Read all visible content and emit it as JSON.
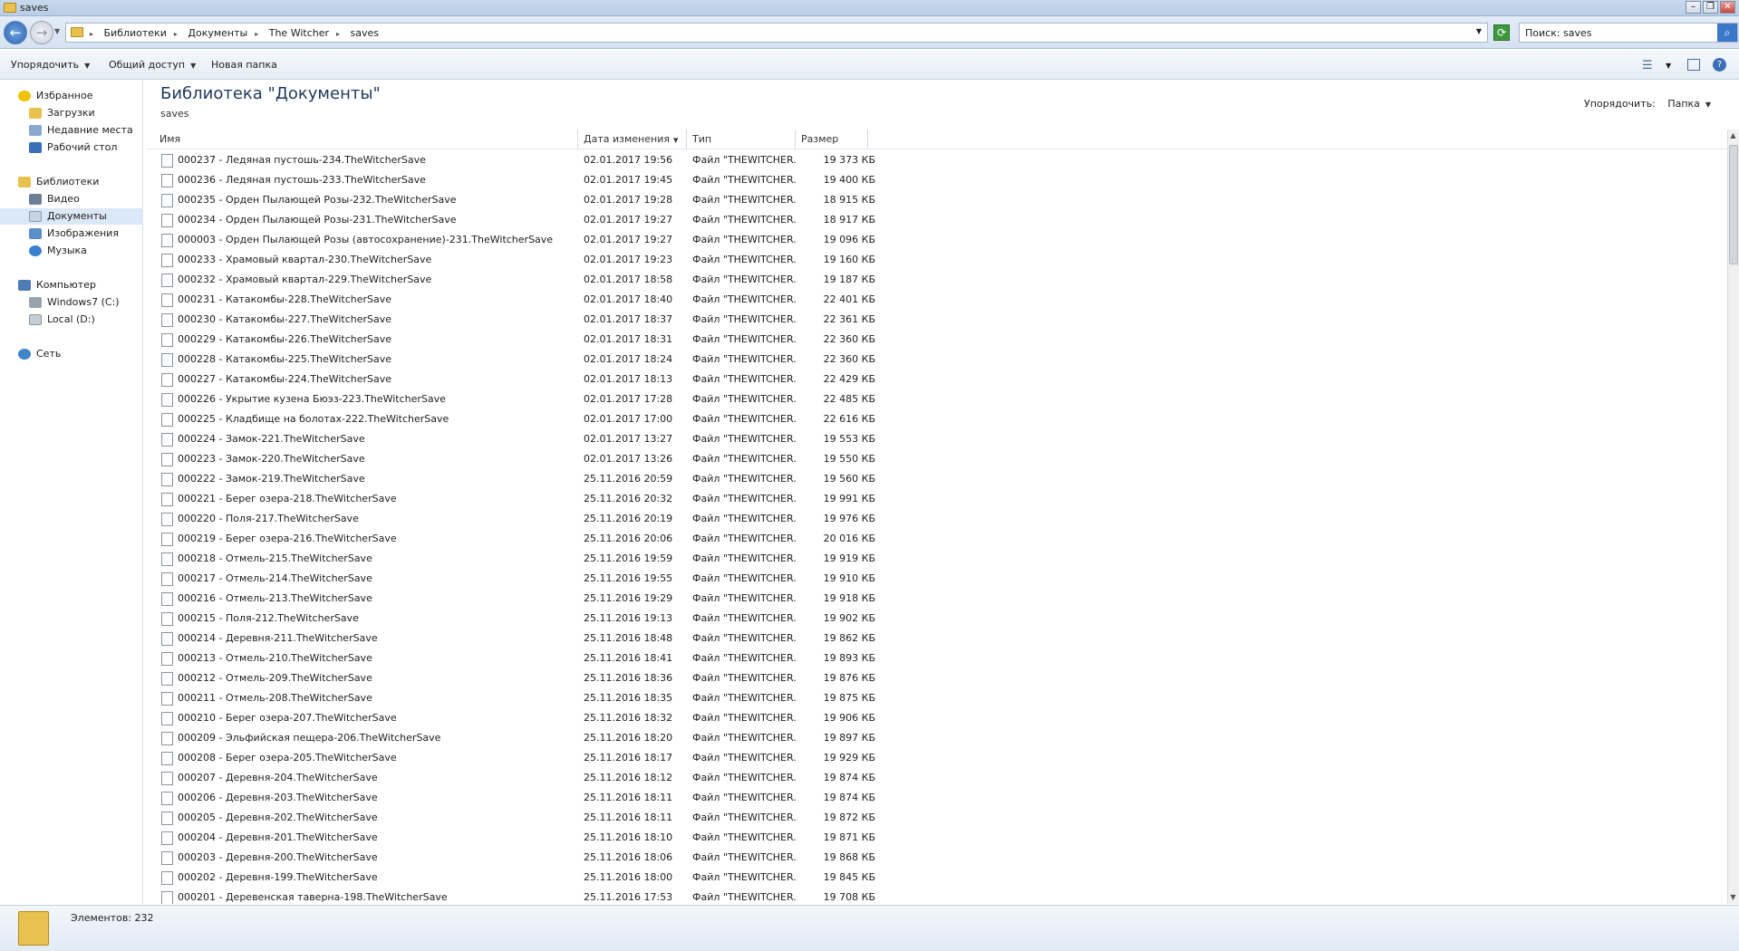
{
  "window": {
    "title": "saves"
  },
  "breadcrumbs": [
    "Библиотеки",
    "Документы",
    "The Witcher",
    "saves"
  ],
  "search": {
    "value": "Поиск: saves"
  },
  "toolbar": {
    "organize": "Упорядочить",
    "share": "Общий доступ",
    "new_folder": "Новая папка"
  },
  "nav": {
    "favorites": "Избранное",
    "downloads": "Загрузки",
    "recent": "Недавние места",
    "desktop": "Рабочий стол",
    "libraries": "Библиотеки",
    "video": "Видео",
    "documents": "Документы",
    "images": "Изображения",
    "music": "Музыка",
    "computer": "Компьютер",
    "drive_c": "Windows7 (C:)",
    "drive_d": "Local (D:)",
    "network": "Сеть"
  },
  "header": {
    "title": "Библиотека \"Документы\"",
    "subtitle": "saves",
    "arrange_label": "Упорядочить:",
    "arrange_value": "Папка"
  },
  "columns": {
    "name": "Имя",
    "date": "Дата изменения",
    "type": "Тип",
    "size": "Размер"
  },
  "files": [
    {
      "name": "000237 - Ледяная пустошь-234.TheWitcherSave",
      "date": "02.01.2017 19:56",
      "type": "Файл \"THEWITCHER...",
      "size": "19 373 КБ"
    },
    {
      "name": "000236 - Ледяная пустошь-233.TheWitcherSave",
      "date": "02.01.2017 19:45",
      "type": "Файл \"THEWITCHER...",
      "size": "19 400 КБ"
    },
    {
      "name": "000235 - Орден Пылающей Розы-232.TheWitcherSave",
      "date": "02.01.2017 19:28",
      "type": "Файл \"THEWITCHER...",
      "size": "18 915 КБ"
    },
    {
      "name": "000234 - Орден Пылающей Розы-231.TheWitcherSave",
      "date": "02.01.2017 19:27",
      "type": "Файл \"THEWITCHER...",
      "size": "18 917 КБ"
    },
    {
      "name": "000003 - Орден Пылающей Розы (автосохранение)-231.TheWitcherSave",
      "date": "02.01.2017 19:27",
      "type": "Файл \"THEWITCHER...",
      "size": "19 096 КБ"
    },
    {
      "name": "000233 - Храмовый квартал-230.TheWitcherSave",
      "date": "02.01.2017 19:23",
      "type": "Файл \"THEWITCHER...",
      "size": "19 160 КБ"
    },
    {
      "name": "000232 - Храмовый квартал-229.TheWitcherSave",
      "date": "02.01.2017 18:58",
      "type": "Файл \"THEWITCHER...",
      "size": "19 187 КБ"
    },
    {
      "name": "000231 - Катакомбы-228.TheWitcherSave",
      "date": "02.01.2017 18:40",
      "type": "Файл \"THEWITCHER...",
      "size": "22 401 КБ"
    },
    {
      "name": "000230 - Катакомбы-227.TheWitcherSave",
      "date": "02.01.2017 18:37",
      "type": "Файл \"THEWITCHER...",
      "size": "22 361 КБ"
    },
    {
      "name": "000229 - Катакомбы-226.TheWitcherSave",
      "date": "02.01.2017 18:31",
      "type": "Файл \"THEWITCHER...",
      "size": "22 360 КБ"
    },
    {
      "name": "000228 - Катакомбы-225.TheWitcherSave",
      "date": "02.01.2017 18:24",
      "type": "Файл \"THEWITCHER...",
      "size": "22 360 КБ"
    },
    {
      "name": "000227 - Катакомбы-224.TheWitcherSave",
      "date": "02.01.2017 18:13",
      "type": "Файл \"THEWITCHER...",
      "size": "22 429 КБ"
    },
    {
      "name": "000226 - Укрытие кузена Бюэз-223.TheWitcherSave",
      "date": "02.01.2017 17:28",
      "type": "Файл \"THEWITCHER...",
      "size": "22 485 КБ"
    },
    {
      "name": "000225 - Кладбище на болотах-222.TheWitcherSave",
      "date": "02.01.2017 17:00",
      "type": "Файл \"THEWITCHER...",
      "size": "22 616 КБ"
    },
    {
      "name": "000224 - Замок-221.TheWitcherSave",
      "date": "02.01.2017 13:27",
      "type": "Файл \"THEWITCHER...",
      "size": "19 553 КБ"
    },
    {
      "name": "000223 - Замок-220.TheWitcherSave",
      "date": "02.01.2017 13:26",
      "type": "Файл \"THEWITCHER...",
      "size": "19 550 КБ"
    },
    {
      "name": "000222 - Замок-219.TheWitcherSave",
      "date": "25.11.2016 20:59",
      "type": "Файл \"THEWITCHER...",
      "size": "19 560 КБ"
    },
    {
      "name": "000221 - Берег озера-218.TheWitcherSave",
      "date": "25.11.2016 20:32",
      "type": "Файл \"THEWITCHER...",
      "size": "19 991 КБ"
    },
    {
      "name": "000220 - Поля-217.TheWitcherSave",
      "date": "25.11.2016 20:19",
      "type": "Файл \"THEWITCHER...",
      "size": "19 976 КБ"
    },
    {
      "name": "000219 - Берег озера-216.TheWitcherSave",
      "date": "25.11.2016 20:06",
      "type": "Файл \"THEWITCHER...",
      "size": "20 016 КБ"
    },
    {
      "name": "000218 - Отмель-215.TheWitcherSave",
      "date": "25.11.2016 19:59",
      "type": "Файл \"THEWITCHER...",
      "size": "19 919 КБ"
    },
    {
      "name": "000217 - Отмель-214.TheWitcherSave",
      "date": "25.11.2016 19:55",
      "type": "Файл \"THEWITCHER...",
      "size": "19 910 КБ"
    },
    {
      "name": "000216 - Отмель-213.TheWitcherSave",
      "date": "25.11.2016 19:29",
      "type": "Файл \"THEWITCHER...",
      "size": "19 918 КБ"
    },
    {
      "name": "000215 - Поля-212.TheWitcherSave",
      "date": "25.11.2016 19:13",
      "type": "Файл \"THEWITCHER...",
      "size": "19 902 КБ"
    },
    {
      "name": "000214 - Деревня-211.TheWitcherSave",
      "date": "25.11.2016 18:48",
      "type": "Файл \"THEWITCHER...",
      "size": "19 862 КБ"
    },
    {
      "name": "000213 - Отмель-210.TheWitcherSave",
      "date": "25.11.2016 18:41",
      "type": "Файл \"THEWITCHER...",
      "size": "19 893 КБ"
    },
    {
      "name": "000212 - Отмель-209.TheWitcherSave",
      "date": "25.11.2016 18:36",
      "type": "Файл \"THEWITCHER...",
      "size": "19 876 КБ"
    },
    {
      "name": "000211 - Отмель-208.TheWitcherSave",
      "date": "25.11.2016 18:35",
      "type": "Файл \"THEWITCHER...",
      "size": "19 875 КБ"
    },
    {
      "name": "000210 - Берег озера-207.TheWitcherSave",
      "date": "25.11.2016 18:32",
      "type": "Файл \"THEWITCHER...",
      "size": "19 906 КБ"
    },
    {
      "name": "000209 - Эльфийская пещера-206.TheWitcherSave",
      "date": "25.11.2016 18:20",
      "type": "Файл \"THEWITCHER...",
      "size": "19 897 КБ"
    },
    {
      "name": "000208 - Берег озера-205.TheWitcherSave",
      "date": "25.11.2016 18:17",
      "type": "Файл \"THEWITCHER...",
      "size": "19 929 КБ"
    },
    {
      "name": "000207 - Деревня-204.TheWitcherSave",
      "date": "25.11.2016 18:12",
      "type": "Файл \"THEWITCHER...",
      "size": "19 874 КБ"
    },
    {
      "name": "000206 - Деревня-203.TheWitcherSave",
      "date": "25.11.2016 18:11",
      "type": "Файл \"THEWITCHER...",
      "size": "19 874 КБ"
    },
    {
      "name": "000205 - Деревня-202.TheWitcherSave",
      "date": "25.11.2016 18:11",
      "type": "Файл \"THEWITCHER...",
      "size": "19 872 КБ"
    },
    {
      "name": "000204 - Деревня-201.TheWitcherSave",
      "date": "25.11.2016 18:10",
      "type": "Файл \"THEWITCHER...",
      "size": "19 871 КБ"
    },
    {
      "name": "000203 - Деревня-200.TheWitcherSave",
      "date": "25.11.2016 18:06",
      "type": "Файл \"THEWITCHER...",
      "size": "19 868 КБ"
    },
    {
      "name": "000202 - Деревня-199.TheWitcherSave",
      "date": "25.11.2016 18:00",
      "type": "Файл \"THEWITCHER...",
      "size": "19 845 КБ"
    },
    {
      "name": "000201 - Деревенская таверна-198.TheWitcherSave",
      "date": "25.11.2016 17:53",
      "type": "Файл \"THEWITCHER...",
      "size": "19 708 КБ"
    }
  ],
  "status": {
    "count": "Элементов: 232"
  }
}
